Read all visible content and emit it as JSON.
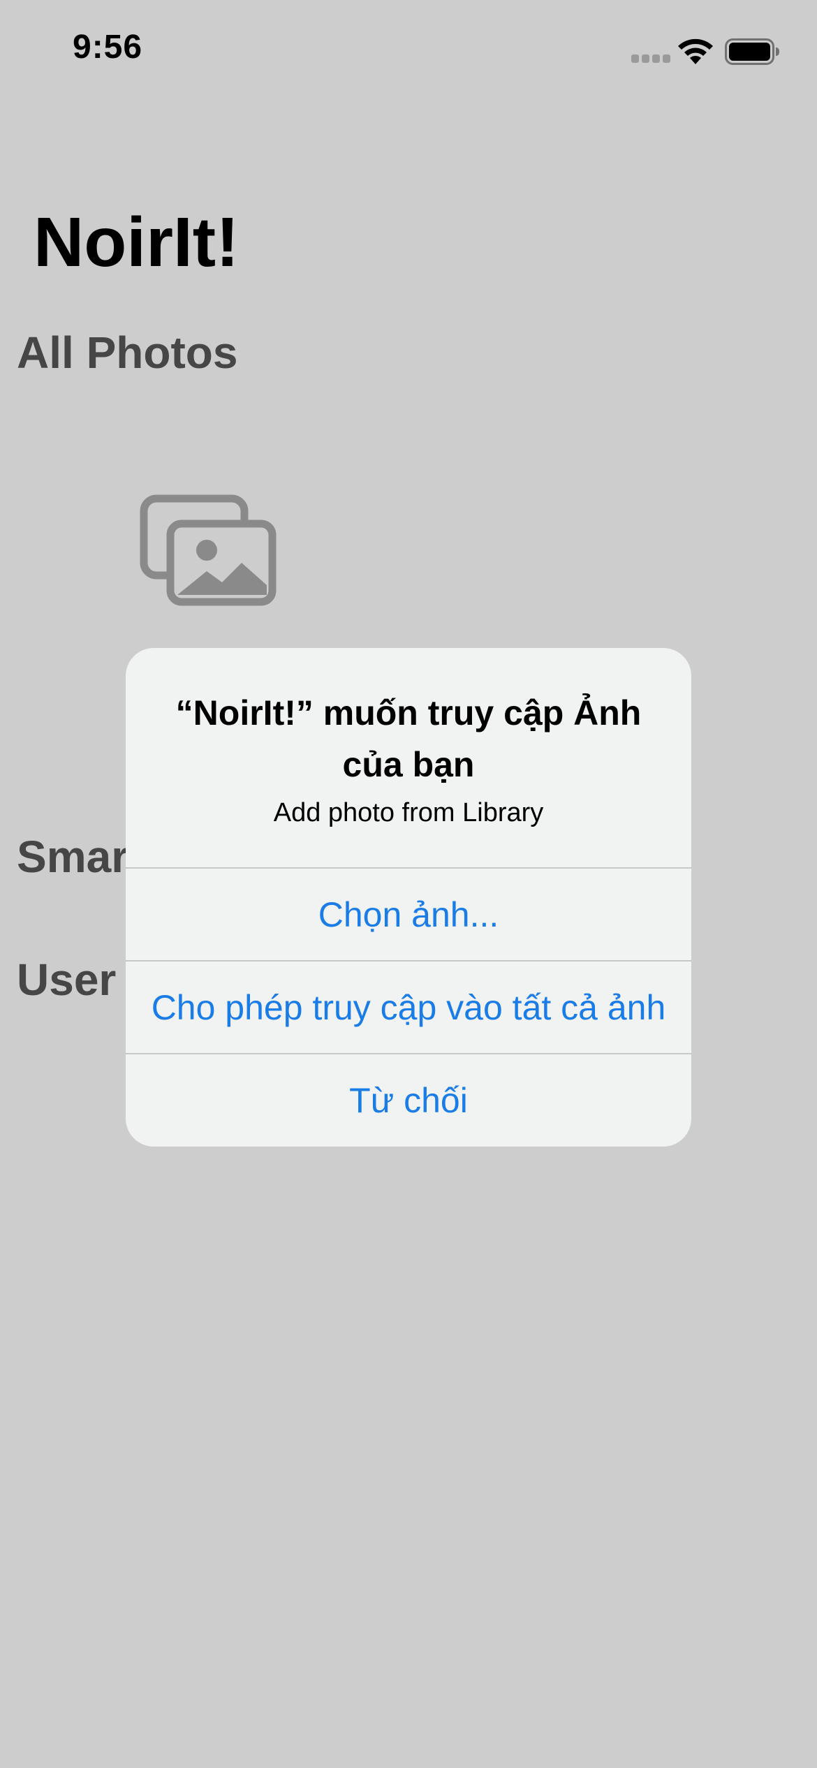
{
  "status_bar": {
    "time": "9:56"
  },
  "app": {
    "title": "NoirIt!",
    "sections": {
      "all_photos": "All Photos",
      "smart": "Smar",
      "user": "User"
    },
    "icons": {
      "photos": "photo-stack-icon"
    }
  },
  "alert": {
    "title": "“NoirIt!” muốn truy cập Ảnh của bạn",
    "message": "Add photo from Library",
    "buttons": {
      "select_photos": "Chọn ảnh...",
      "allow_all": "Cho phép truy cập vào tất cả ảnh",
      "deny": "Từ chối"
    }
  },
  "colors": {
    "background": "#cdcdcd",
    "alert_background": "#f1f2f2",
    "button_text": "#1a7ce6",
    "section_text": "#464646",
    "icon_gray": "#8a8a8a"
  }
}
